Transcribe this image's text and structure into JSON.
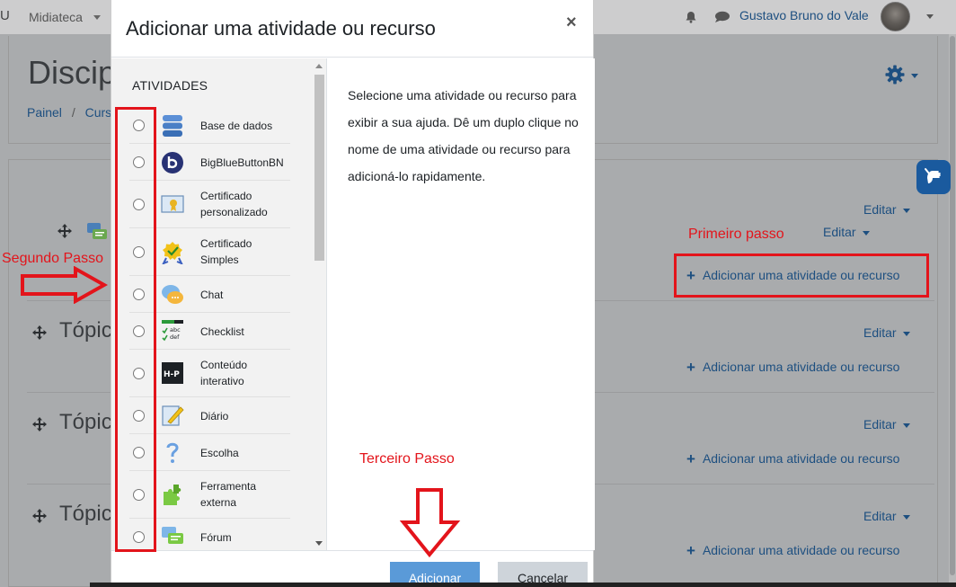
{
  "navbar": {
    "partial_left": "U",
    "midiateca": "Midiateca",
    "user_name": "Gustavo Bruno do Vale"
  },
  "page": {
    "title": "Discip",
    "breadcrumb": [
      "Painel",
      "Curs"
    ]
  },
  "course": {
    "sections": [
      {
        "title": "",
        "edit_label_1": "Editar",
        "edit_label_2": "Editar",
        "add_label": "Adicionar uma atividade ou recurso"
      },
      {
        "title": "Tópic",
        "edit_label": "Editar",
        "add_label": "Adicionar uma atividade ou recurso"
      },
      {
        "title": "Tópic",
        "edit_label": "Editar",
        "add_label": "Adicionar uma atividade ou recurso"
      },
      {
        "title": "Tópic",
        "edit_label": "Editar",
        "add_label": "Adicionar uma atividade ou recurso"
      }
    ]
  },
  "annotations": {
    "first_step": "Primeiro passo",
    "second_step": "Segundo Passo",
    "third_step": "Terceiro Passo"
  },
  "modal": {
    "title": "Adicionar uma atividade ou recurso",
    "close_symbol": "×",
    "section_header": "ATIVIDADES",
    "options": [
      {
        "label": "Base de dados",
        "icon": "database-icon"
      },
      {
        "label": "BigBlueButtonBN",
        "icon": "bigbluebutton-icon"
      },
      {
        "label": "Certificado personalizado",
        "icon": "custom-certificate-icon"
      },
      {
        "label": "Certificado Simples",
        "icon": "simple-certificate-icon"
      },
      {
        "label": "Chat",
        "icon": "chat-icon"
      },
      {
        "label": "Checklist",
        "icon": "checklist-icon"
      },
      {
        "label": "Conteúdo interativo",
        "icon": "h5p-icon"
      },
      {
        "label": "Diário",
        "icon": "journal-icon"
      },
      {
        "label": "Escolha",
        "icon": "choice-icon"
      },
      {
        "label": "Ferramenta externa",
        "icon": "external-tool-icon"
      },
      {
        "label": "Fórum",
        "icon": "forum-icon"
      }
    ],
    "help_text": "Selecione uma atividade ou recurso para exibir a sua ajuda. Dê um duplo clique no nome de uma atividade ou recurso para adicioná-lo rapidamente.",
    "add_button": "Adicionar",
    "cancel_button": "Cancelar"
  },
  "colors": {
    "annotation_red": "#e3141b",
    "link_blue": "#1d4f80",
    "primary_button": "#5a9ad8"
  }
}
